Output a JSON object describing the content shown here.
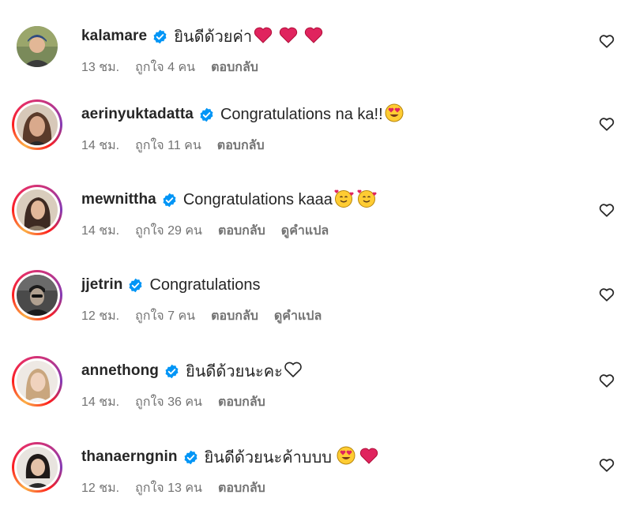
{
  "comments": [
    {
      "username": "kalamare",
      "text": "ยินดีด้วยค่า",
      "emoji": [
        "red-heart",
        "red-heart",
        "red-heart"
      ],
      "time": "13 ชม.",
      "likes": "ถูกใจ 4 คน",
      "reply": "ตอบกลับ",
      "translate": "",
      "story_ring": false
    },
    {
      "username": "aerinyuktadatta",
      "text": "Congratulations na ka!!",
      "emoji": [
        "heart-eyes"
      ],
      "time": "14 ชม.",
      "likes": "ถูกใจ 11 คน",
      "reply": "ตอบกลับ",
      "translate": "",
      "story_ring": true
    },
    {
      "username": "mewnittha",
      "text": "Congratulations kaaa",
      "emoji": [
        "smiling-hearts",
        "smiling-hearts"
      ],
      "time": "14 ชม.",
      "likes": "ถูกใจ 29 คน",
      "reply": "ตอบกลับ",
      "translate": "ดูคำแปล",
      "story_ring": true
    },
    {
      "username": "jjetrin",
      "text": "Congratulations",
      "emoji": [],
      "time": "12 ชม.",
      "likes": "ถูกใจ 7 คน",
      "reply": "ตอบกลับ",
      "translate": "ดูคำแปล",
      "story_ring": true
    },
    {
      "username": "annethong",
      "text": "ยินดีด้วยนะคะ",
      "emoji": [
        "white-heart"
      ],
      "time": "14 ชม.",
      "likes": "ถูกใจ 36 คน",
      "reply": "ตอบกลับ",
      "translate": "",
      "story_ring": true
    },
    {
      "username": "thanaerngnin",
      "text": "ยินดีด้วยนะค้าบบบ ",
      "emoji": [
        "heart-eyes",
        "red-heart"
      ],
      "time": "12 ชม.",
      "likes": "ถูกใจ 13 คน",
      "reply": "ตอบกลับ",
      "translate": "",
      "story_ring": true
    }
  ],
  "icons": {
    "verified": "verified-badge-icon",
    "like": "heart-outline-icon"
  },
  "colors": {
    "verified": "#0095f6",
    "meta_text": "#737373",
    "heart_red": "#e0245e"
  }
}
